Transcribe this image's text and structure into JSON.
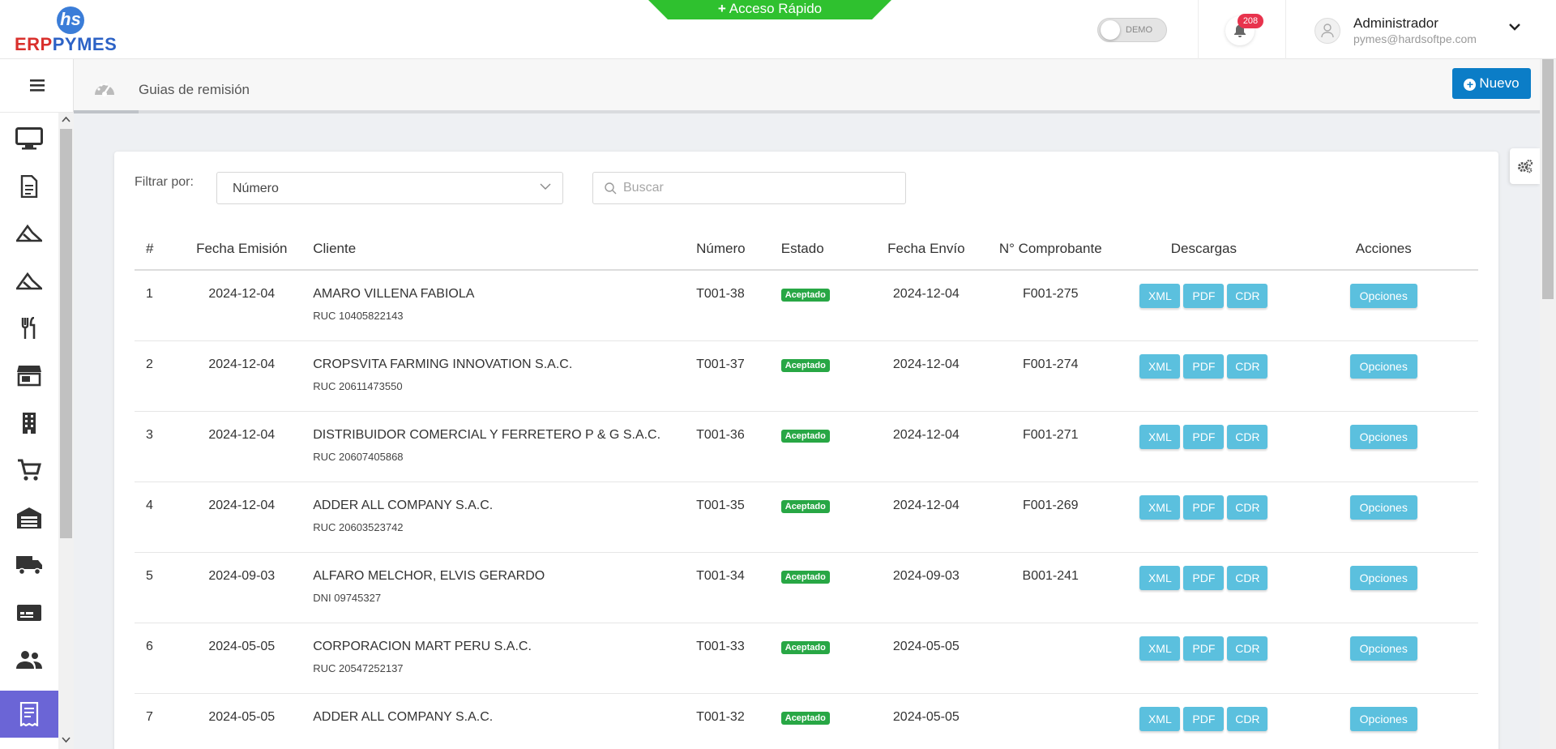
{
  "brand": {
    "logo_mark": "hs",
    "logo_part1": "ERP",
    "logo_part2": "PYMES"
  },
  "header": {
    "quick_access": "Acceso Rápido",
    "demo_label": "DEMO",
    "notifications_count": "208",
    "user_name": "Administrador",
    "user_email": "pymes@hardsoftpe.com"
  },
  "sidebar": {
    "icons": [
      "monitor-icon",
      "document-icon",
      "plane-icon",
      "plane-alt-icon",
      "restaurant-icon",
      "store-icon",
      "building-icon",
      "cart-icon",
      "warehouse-icon",
      "truck-icon",
      "card-icon",
      "users-icon",
      "receipt-icon"
    ],
    "active_index": 12
  },
  "breadcrumb": {
    "title": "Guias de remisión"
  },
  "actions": {
    "new_label": "Nuevo"
  },
  "filter": {
    "label": "Filtrar por:",
    "selected": "Número",
    "search_placeholder": "Buscar"
  },
  "table": {
    "headers": {
      "index": "#",
      "date": "Fecha Emisión",
      "client": "Cliente",
      "number": "Número",
      "status": "Estado",
      "sent_date": "Fecha Envío",
      "voucher": "N° Comprobante",
      "downloads": "Descargas",
      "actions": "Acciones"
    },
    "download_labels": [
      "XML",
      "PDF",
      "CDR"
    ],
    "options_label": "Opciones",
    "rows": [
      {
        "index": "1",
        "date": "2024-12-04",
        "client": "AMARO VILLENA FABIOLA",
        "doc": "RUC 10405822143",
        "number": "T001-38",
        "status": "Aceptado",
        "sent_date": "2024-12-04",
        "voucher": "F001-275"
      },
      {
        "index": "2",
        "date": "2024-12-04",
        "client": "CROPSVITA FARMING INNOVATION S.A.C.",
        "doc": "RUC 20611473550",
        "number": "T001-37",
        "status": "Aceptado",
        "sent_date": "2024-12-04",
        "voucher": "F001-274"
      },
      {
        "index": "3",
        "date": "2024-12-04",
        "client": "DISTRIBUIDOR COMERCIAL Y FERRETERO P & G S.A.C.",
        "doc": "RUC 20607405868",
        "number": "T001-36",
        "status": "Aceptado",
        "sent_date": "2024-12-04",
        "voucher": "F001-271"
      },
      {
        "index": "4",
        "date": "2024-12-04",
        "client": "ADDER ALL COMPANY S.A.C.",
        "doc": "RUC 20603523742",
        "number": "T001-35",
        "status": "Aceptado",
        "sent_date": "2024-12-04",
        "voucher": "F001-269"
      },
      {
        "index": "5",
        "date": "2024-09-03",
        "client": "ALFARO MELCHOR, ELVIS GERARDO",
        "doc": "DNI 09745327",
        "number": "T001-34",
        "status": "Aceptado",
        "sent_date": "2024-09-03",
        "voucher": "B001-241"
      },
      {
        "index": "6",
        "date": "2024-05-05",
        "client": "CORPORACION MART PERU S.A.C.",
        "doc": "RUC 20547252137",
        "number": "T001-33",
        "status": "Aceptado",
        "sent_date": "2024-05-05",
        "voucher": ""
      },
      {
        "index": "7",
        "date": "2024-05-05",
        "client": "ADDER ALL COMPANY S.A.C.",
        "doc": "",
        "number": "T001-32",
        "status": "Aceptado",
        "sent_date": "2024-05-05",
        "voucher": ""
      }
    ]
  },
  "colors": {
    "accent": "#0b7dc7",
    "info_button": "#5bc0de",
    "success": "#28a745",
    "sidebar_active": "#6b65d6",
    "quick_access": "#2fc12f",
    "badge": "#e8334d"
  }
}
